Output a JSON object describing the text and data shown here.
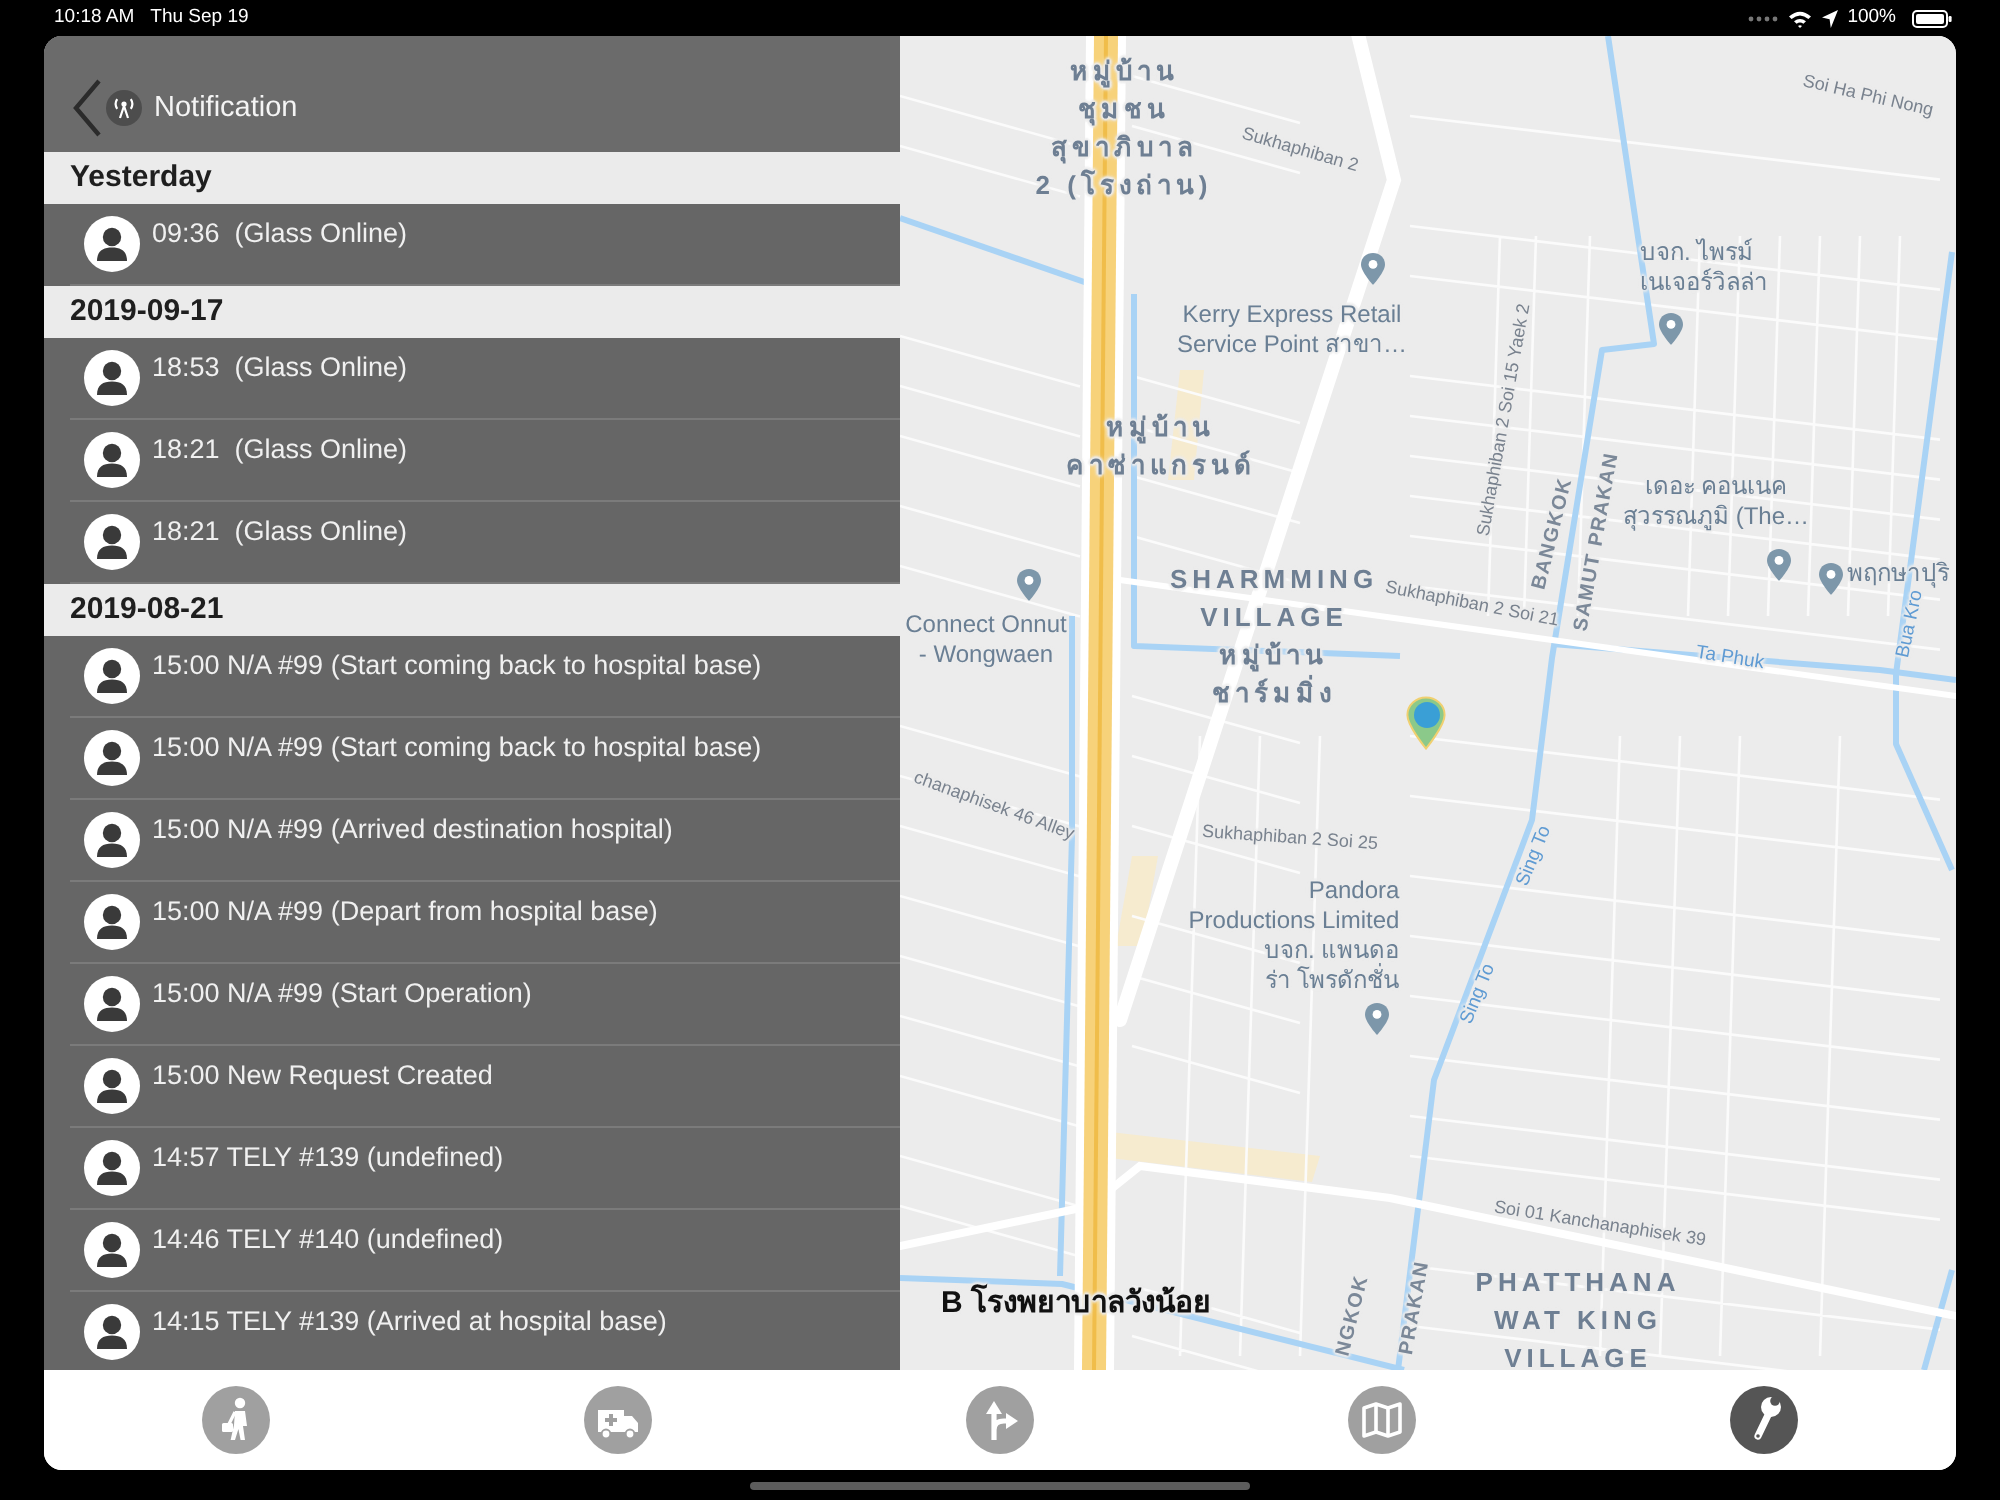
{
  "status_bar": {
    "time": "10:18 AM",
    "date": "Thu Sep 19",
    "battery": "100%"
  },
  "nav_bar": {
    "title": "Notification"
  },
  "sections": [
    {
      "title": "Yesterday",
      "items": [
        {
          "text": "09:36  (Glass Online)"
        }
      ]
    },
    {
      "title": "2019-09-17",
      "items": [
        {
          "text": "18:53  (Glass Online)"
        },
        {
          "text": "18:21  (Glass Online)"
        },
        {
          "text": "18:21  (Glass Online)"
        }
      ]
    },
    {
      "title": "2019-08-21",
      "items": [
        {
          "text": "15:00 N/A #99 (Start coming back to hospital base)"
        },
        {
          "text": "15:00 N/A #99 (Start coming back to hospital base)"
        },
        {
          "text": "15:00 N/A #99 (Arrived destination hospital)"
        },
        {
          "text": "15:00 N/A #99 (Depart from hospital base)"
        },
        {
          "text": "15:00 N/A #99 (Start Operation)"
        },
        {
          "text": "15:00 New Request Created"
        },
        {
          "text": "14:57 TELY #139 (undefined)"
        },
        {
          "text": "14:46 TELY #140 (undefined)"
        },
        {
          "text": "14:15 TELY #139 (Arrived at hospital base)"
        }
      ]
    }
  ],
  "map": {
    "labels": [
      {
        "kind": "area",
        "text": "หมู่บ้าน\nชุมชน\nสุขาภิบาล\n2 (โรงถ่าน)"
      },
      {
        "kind": "road",
        "text": "Sukhaphiban 2"
      },
      {
        "kind": "road",
        "text": "Soi Ha Phi Nong"
      },
      {
        "kind": "poi",
        "text": "Kerry Express Retail\nService Point สาขา…"
      },
      {
        "kind": "poi",
        "text": "บจก. ไพรม์\nเนเจอร์วิลล่า"
      },
      {
        "kind": "area",
        "text": "หมู่บ้าน\nคาซ่าแกรนด์"
      },
      {
        "kind": "road",
        "text": "Sukhaphiban 2 Soi 15 Yaek 2"
      },
      {
        "kind": "boundary",
        "text": "BANGKOK"
      },
      {
        "kind": "boundary",
        "text": "SAMUT PRAKAN"
      },
      {
        "kind": "poi",
        "text": "เดอะ คอนเนค\nสุวรรณภูมิ (The…"
      },
      {
        "kind": "poi",
        "text": "พฤกษาปุริ"
      },
      {
        "kind": "poi",
        "text": "Connect Onnut\n- Wongwaen"
      },
      {
        "kind": "area",
        "text": "SHARMMING\nVILLAGE\nหมู่บ้าน\nชาร์มมิ่ง"
      },
      {
        "kind": "road",
        "text": "Sukhaphiban 2 Soi 21"
      },
      {
        "kind": "water",
        "text": "Ta Phuk"
      },
      {
        "kind": "water",
        "text": "Bua Kro"
      },
      {
        "kind": "road",
        "text": "chanaphisek 46 Alley"
      },
      {
        "kind": "road",
        "text": "Sukhaphiban 2 Soi 25"
      },
      {
        "kind": "poi",
        "text": "Pandora\nProductions Limited\nบจก. แพนดอ\nร่า โพรดักชั่น"
      },
      {
        "kind": "water",
        "text": "Sing To"
      },
      {
        "kind": "water",
        "text": "Sing To"
      },
      {
        "kind": "road",
        "text": "Soi 01 Kanchanaphisek 39"
      },
      {
        "kind": "hospital",
        "text": "B โรงพยาบาลวังน้อย"
      },
      {
        "kind": "boundary",
        "text": "NGKOK"
      },
      {
        "kind": "boundary",
        "text": "PRAKAN"
      },
      {
        "kind": "area",
        "text": "PHATTHANA\nWAT KING\nVILLAGE"
      }
    ]
  },
  "tabs": [
    {
      "kind": "staff",
      "selected": false
    },
    {
      "kind": "ambulance",
      "selected": false
    },
    {
      "kind": "route",
      "selected": false
    },
    {
      "kind": "map",
      "selected": false
    },
    {
      "kind": "tools",
      "selected": true
    }
  ]
}
